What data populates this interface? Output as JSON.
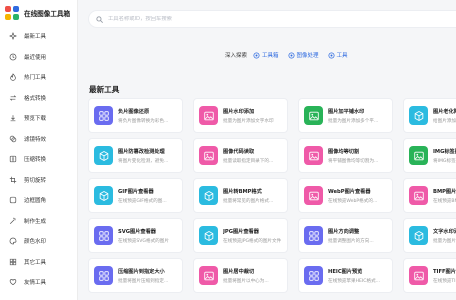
{
  "brand": {
    "title": "在线图像工具箱",
    "logo_colors": [
      "#ef4f47",
      "#2f6be0",
      "#f6b500",
      "#2bb36b"
    ]
  },
  "sidebar": {
    "items": [
      {
        "label": "最新工具",
        "icon": "sparkle-icon"
      },
      {
        "label": "最近使用",
        "icon": "clock-icon"
      },
      {
        "label": "热门工具",
        "icon": "flame-icon"
      },
      {
        "label": "格式转换",
        "icon": "convert-icon"
      },
      {
        "label": "预览下载",
        "icon": "download-icon"
      },
      {
        "label": "滤镜特效",
        "icon": "filter-icon"
      },
      {
        "label": "压缩转换",
        "icon": "compress-icon"
      },
      {
        "label": "剪切旋转",
        "icon": "crop-icon"
      },
      {
        "label": "边框圆角",
        "icon": "frame-icon"
      },
      {
        "label": "制作生成",
        "icon": "wand-icon"
      },
      {
        "label": "颜色水印",
        "icon": "palette-icon"
      },
      {
        "label": "其它工具",
        "icon": "grid-icon"
      },
      {
        "label": "友情工具",
        "icon": "heart-icon"
      }
    ]
  },
  "search": {
    "placeholder": "工具名称或ID，按回车搜索"
  },
  "explore": {
    "label": "深入探索",
    "chips": [
      {
        "label": "工具箱"
      },
      {
        "label": "图像处理"
      },
      {
        "label": "工具"
      }
    ]
  },
  "section": {
    "title": "最新工具"
  },
  "tools": [
    {
      "title": "负片图像还原",
      "desc": "将负片图像转换为彩色...",
      "color": "#6a6cf0",
      "icon": "grid-icon"
    },
    {
      "title": "图片水印添加",
      "desc": "批量为图片添加文字水印",
      "color": "#ef5aa8",
      "icon": "image-icon"
    },
    {
      "title": "图片加平铺水印",
      "desc": "批量为图片添加多个平...",
      "color": "#29b358",
      "icon": "image-icon"
    },
    {
      "title": "图片老化降化",
      "desc": "给图片添加老化效果",
      "color": "#2bbbe0",
      "icon": "cube-icon"
    },
    {
      "title": "图片防篡改检测处理",
      "desc": "将图片变化检测，避免...",
      "color": "#2bbbe0",
      "icon": "cube-icon"
    },
    {
      "title": "图像代码读取",
      "desc": "批量读取指定目录下的...",
      "color": "#ef5aa8",
      "icon": "image-icon"
    },
    {
      "title": "图像均等切割",
      "desc": "将平铺图像均等切割为...",
      "color": "#ef5aa8",
      "icon": "image-icon"
    },
    {
      "title": "IMG标签图像化",
      "desc": "将IMG标签内图像转换...",
      "color": "#29b358",
      "icon": "image-icon"
    },
    {
      "title": "GIF图片查看器",
      "desc": "在线预览GIF格式的图...",
      "color": "#2bbbe0",
      "icon": "cube-icon"
    },
    {
      "title": "图片转BMP格式",
      "desc": "批量将常见的图片格式...",
      "color": "#2bbbe0",
      "icon": "cube-icon"
    },
    {
      "title": "WebP图片查看器",
      "desc": "在线预览WebP格式的...",
      "color": "#ef5aa8",
      "icon": "image-icon"
    },
    {
      "title": "BMP图片查看器",
      "desc": "在线预览BMP格式的...",
      "color": "#ef5aa8",
      "icon": "image-icon"
    },
    {
      "title": "SVG图片查看器",
      "desc": "在线预览SVG格式的图片",
      "color": "#6a6cf0",
      "icon": "grid-icon"
    },
    {
      "title": "JPG图片查看器",
      "desc": "在线预览JPG格式的图片文件",
      "color": "#2bbbe0",
      "icon": "cube-icon"
    },
    {
      "title": "图片方向调整",
      "desc": "批量调整图片的方向...",
      "color": "#6a6cf0",
      "icon": "grid-icon"
    },
    {
      "title": "文字水印添加",
      "desc": "批量为图片添加文字...",
      "color": "#2bbbe0",
      "icon": "cube-icon"
    },
    {
      "title": "压缩图片到指定大小",
      "desc": "批量将图片压缩到指定...",
      "color": "#6a6cf0",
      "icon": "grid-icon"
    },
    {
      "title": "图片居中裁切",
      "desc": "批量将图片以中心为...",
      "color": "#ef5aa8",
      "icon": "image-icon"
    },
    {
      "title": "HEIC图片预览",
      "desc": "在线预览苹果HEIC格式...",
      "color": "#6a6cf0",
      "icon": "grid-icon"
    },
    {
      "title": "TIFF图片查看器",
      "desc": "在线预览TIFF格式的...",
      "color": "#ef5aa8",
      "icon": "image-icon"
    }
  ]
}
